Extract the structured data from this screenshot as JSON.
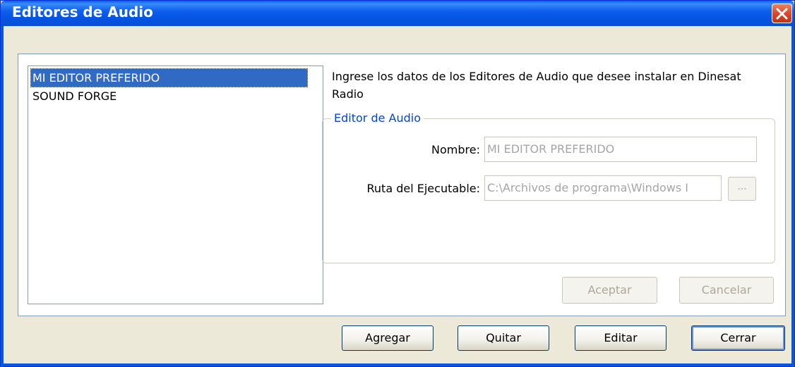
{
  "window": {
    "title": "Editores de Audio"
  },
  "list": {
    "items": [
      {
        "label": "MI EDITOR PREFERIDO",
        "selected": true
      },
      {
        "label": "SOUND FORGE",
        "selected": false
      }
    ]
  },
  "description": "Ingrese los datos de los Editores de Audio que desee instalar en Dinesat Radio",
  "editor_group": {
    "title": "Editor de Audio",
    "name_label": "Nombre:",
    "name_value": "MI EDITOR PREFERIDO",
    "path_label": "Ruta del Ejecutable:",
    "path_value": "C:\\Archivos de programa\\Windows I",
    "browse_label": "..."
  },
  "form_buttons": {
    "accept": "Aceptar",
    "cancel": "Cancelar"
  },
  "bottom_buttons": {
    "add": "Agregar",
    "remove": "Quitar",
    "edit": "Editar",
    "close": "Cerrar"
  },
  "colors": {
    "titlebar": "#0a5ee8",
    "selection": "#316ac5",
    "group_title": "#0046d5"
  }
}
